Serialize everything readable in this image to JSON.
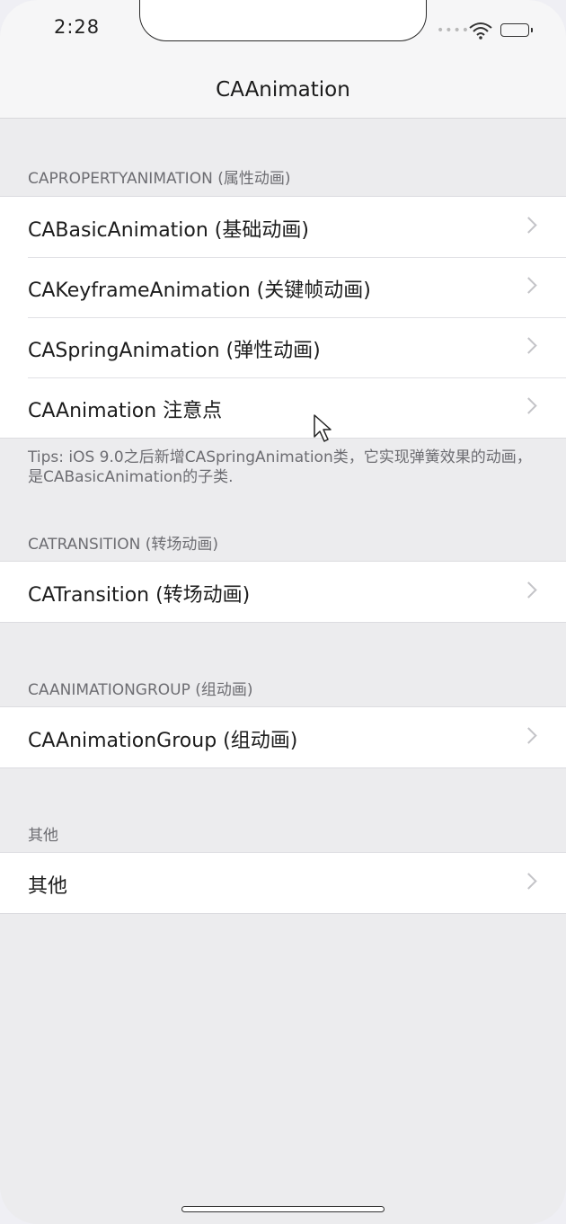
{
  "status_bar": {
    "time": "2:28",
    "signal_dots": "••••"
  },
  "nav": {
    "title": "CAAnimation"
  },
  "sections": [
    {
      "header": "CAPROPERTYANIMATION (属性动画)",
      "items": [
        {
          "label": "CABasicAnimation (基础动画)"
        },
        {
          "label": "CAKeyframeAnimation (关键帧动画)"
        },
        {
          "label": "CASpringAnimation (弹性动画)"
        },
        {
          "label": "CAAnimation 注意点"
        }
      ],
      "footer": "Tips: iOS 9.0之后新增CASpringAnimation类，它实现弹簧效果的动画，是CABasicAnimation的子类."
    },
    {
      "header": "CATRANSITION (转场动画)",
      "items": [
        {
          "label": "CATransition (转场动画)"
        }
      ]
    },
    {
      "header": "CAANIMATIONGROUP (组动画)",
      "items": [
        {
          "label": "CAAnimationGroup (组动画)"
        }
      ]
    },
    {
      "header": "其他",
      "items": [
        {
          "label": "其他"
        }
      ]
    }
  ],
  "icons": {
    "chevron": "chevron-right-icon",
    "wifi": "wifi-icon",
    "battery": "battery-icon",
    "cursor": "cursor-icon"
  },
  "colors": {
    "background": "#ececee",
    "cell_background": "#ffffff",
    "header_text": "#6d6d72",
    "chevron": "#c4c4c8"
  }
}
